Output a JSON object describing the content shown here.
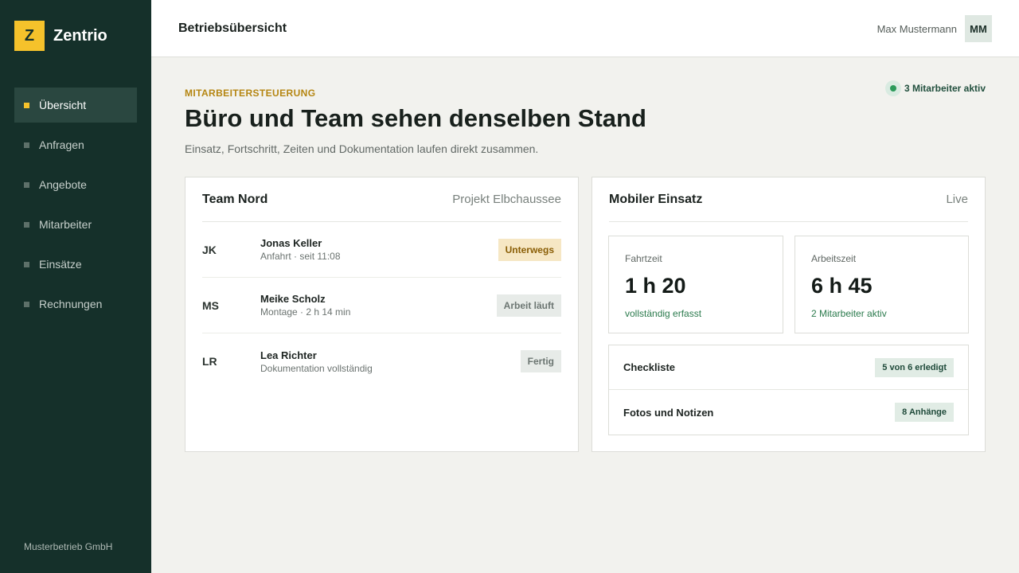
{
  "sidebar": {
    "logo_letter": "Z",
    "brand": "Zentrio",
    "items": [
      {
        "label": "Übersicht",
        "active": true
      },
      {
        "label": "Anfragen"
      },
      {
        "label": "Angebote"
      },
      {
        "label": "Mitarbeiter"
      },
      {
        "label": "Einsätze"
      },
      {
        "label": "Rechnungen"
      }
    ],
    "footer": "Musterbetrieb GmbH"
  },
  "header": {
    "title": "Betriebsübersicht",
    "user_name": "Max Mustermann",
    "avatar_initials": "MM"
  },
  "main": {
    "eyebrow": "MITARBEITERSTEUERUNG",
    "title": "Büro und Team sehen denselben Stand",
    "subtitle": "Einsatz, Fortschritt, Zeiten und Dokumentation laufen direkt zusammen.",
    "active_status": "3 Mitarbeiter aktiv"
  },
  "team_card": {
    "title": "Team Nord",
    "project": "Projekt Elbchaussee",
    "members": [
      {
        "initials": "JK",
        "name": "Jonas Keller",
        "detail": "Anfahrt · seit 11:08",
        "status": "Unterwegs"
      },
      {
        "initials": "MS",
        "name": "Meike Scholz",
        "detail": "Montage · 2 h 14 min",
        "status": "Arbeit läuft"
      },
      {
        "initials": "LR",
        "name": "Lea Richter",
        "detail": "Dokumentation vollständig",
        "status": "Fertig"
      }
    ]
  },
  "mobile_card": {
    "title": "Mobiler Einsatz",
    "live": "Live",
    "stats": [
      {
        "label": "Fahrtzeit",
        "value": "1 h 20",
        "note": "vollständig erfasst"
      },
      {
        "label": "Arbeitszeit",
        "value": "6 h 45",
        "note": "2 Mitarbeiter aktiv"
      }
    ],
    "checklist": {
      "label": "Checkliste",
      "badge": "5 von 6 erledigt"
    },
    "photos": {
      "label": "Fotos und Notizen",
      "badge": "8 Anhänge"
    }
  },
  "colors": {
    "sidebar_bg": "#15302a",
    "accent": "#f5c22b",
    "eyebrow": "#b58612",
    "success": "#2c9a5a",
    "warn_bg": "#f6e7c4"
  }
}
